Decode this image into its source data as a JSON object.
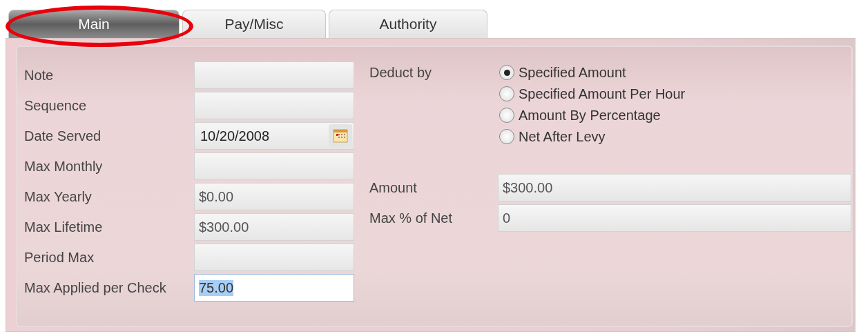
{
  "tabs": [
    {
      "label": "Main",
      "selected": true,
      "circled": true
    },
    {
      "label": "Pay/Misc",
      "selected": false,
      "circled": false
    },
    {
      "label": "Authority",
      "selected": false,
      "circled": false
    }
  ],
  "left_fields": [
    {
      "label": "Note",
      "kind": "text",
      "focused": false
    },
    {
      "label": "Sequence",
      "kind": "text",
      "focused": false
    },
    {
      "label": "Date Served",
      "value": "10/20/2008",
      "kind": "date",
      "focused": false
    },
    {
      "label": "Max Monthly",
      "kind": "text",
      "focused": false
    },
    {
      "label": "Max Yearly",
      "value": "$0.00",
      "kind": "text",
      "focused": false
    },
    {
      "label": "Max Lifetime",
      "value": "$300.00",
      "kind": "text",
      "focused": false
    },
    {
      "label": "Period Max",
      "kind": "text",
      "focused": false
    },
    {
      "label": "Max Applied per Check",
      "value": "75.00",
      "kind": "text",
      "focused": true
    }
  ],
  "deduct_by": {
    "label": "Deduct by",
    "options": [
      {
        "label": "Specified Amount",
        "selected": true
      },
      {
        "label": "Specified Amount Per Hour",
        "selected": false
      },
      {
        "label": "Amount By Percentage",
        "selected": false
      },
      {
        "label": "Net After Levy",
        "selected": false
      }
    ]
  },
  "right_fields": [
    {
      "label": "Amount",
      "value": "$300.00",
      "kind": "text",
      "focused": false
    },
    {
      "label": "Max % of Net",
      "value": "0",
      "kind": "text",
      "focused": false
    }
  ]
}
